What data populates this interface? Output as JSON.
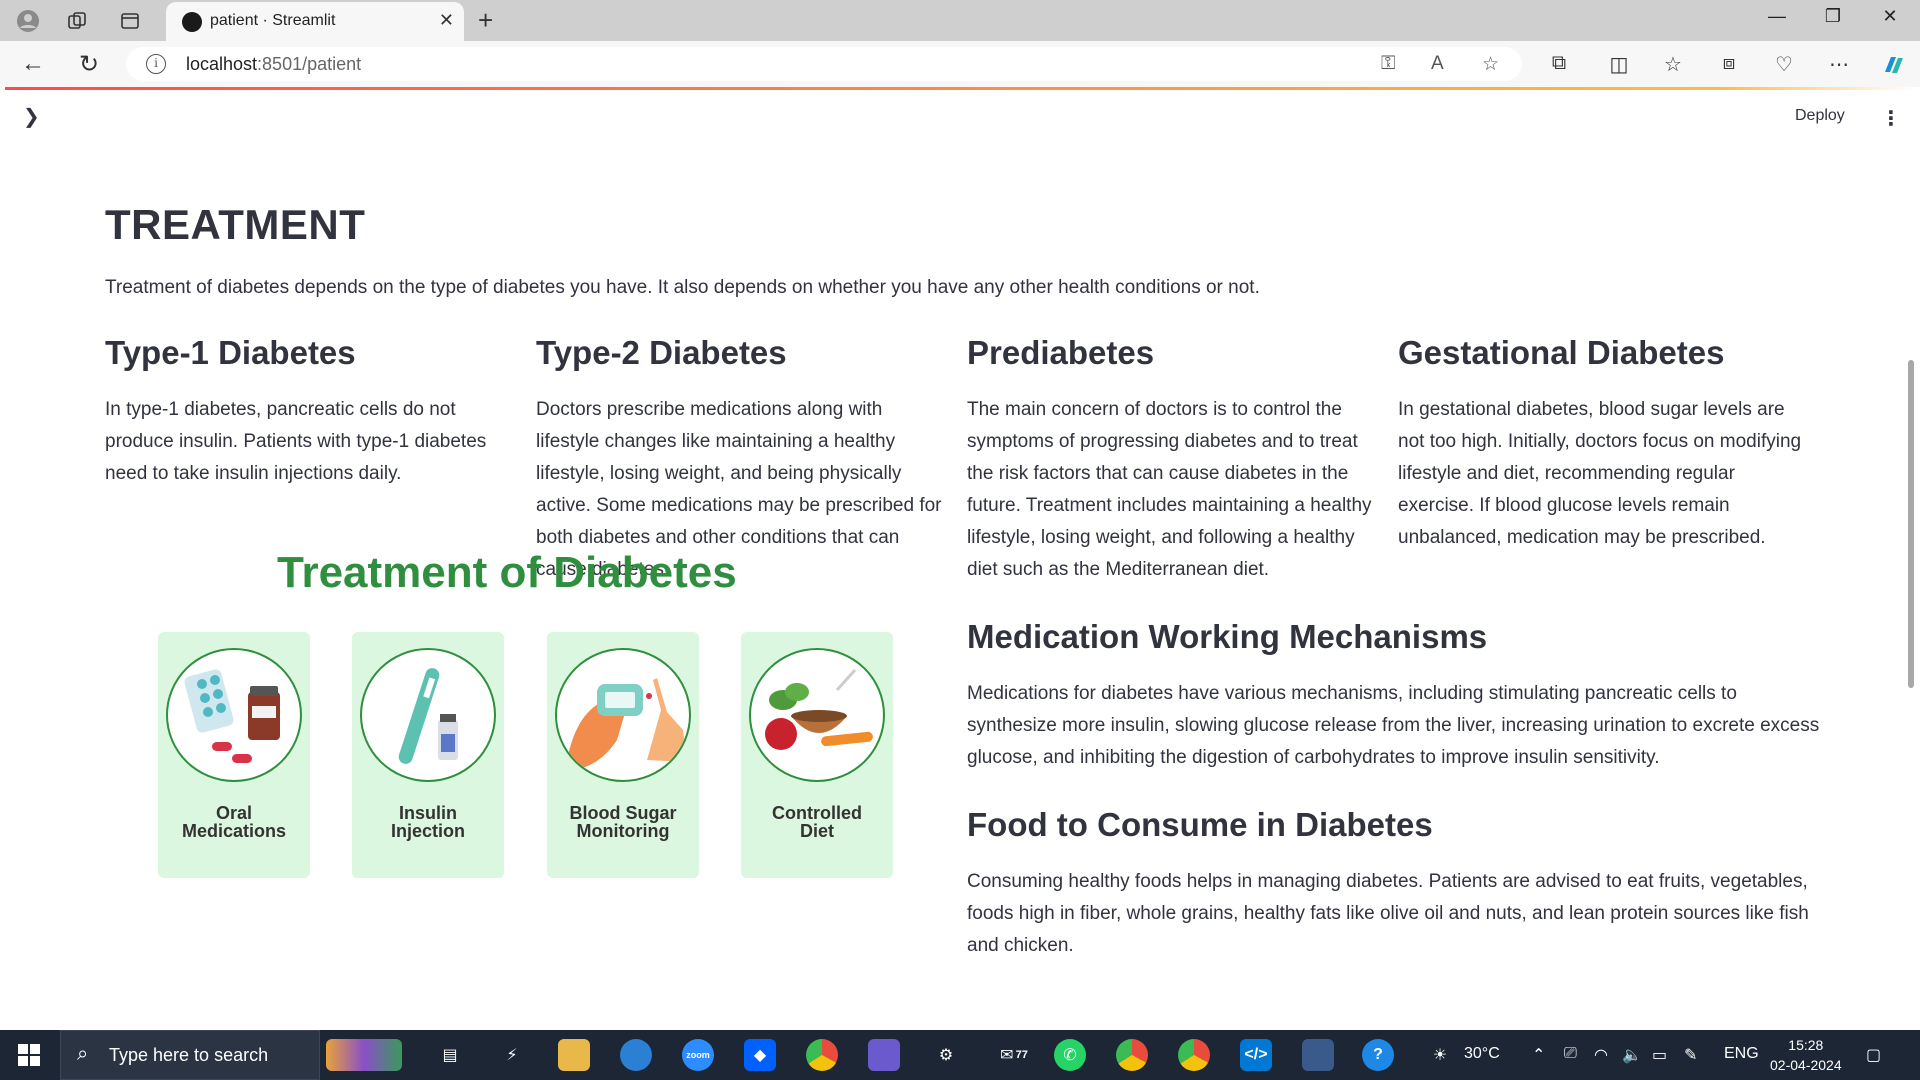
{
  "browser": {
    "tab_title": "patient · Streamlit",
    "url_host": "localhost",
    "url_path": ":8501/patient"
  },
  "header": {
    "deploy_label": "Deploy"
  },
  "main": {
    "title": "TREATMENT",
    "intro": "Treatment of diabetes depends on the type of diabetes you have. It also depends on whether you have any other health conditions or not.",
    "sections": [
      {
        "heading": "Type-1 Diabetes",
        "lines": [
          "In type-1 diabetes, pancreatic cells do not",
          "produce insulin. Patients with type-1 diabetes",
          "need to take insulin injections daily."
        ]
      },
      {
        "heading": "Type-2 Diabetes",
        "lines": [
          "Doctors prescribe medications along with",
          "lifestyle changes like maintaining a healthy",
          "lifestyle, losing weight, and being physically",
          "active. Some medications may be prescribed for",
          "both diabetes and other conditions that can",
          "cause diabetes."
        ]
      },
      {
        "heading": "Prediabetes",
        "lines": [
          "The main concern of doctors is to control the",
          "symptoms of progressing diabetes and to treat",
          "the risk factors that can cause diabetes in the",
          "future. Treatment includes maintaining a healthy",
          "lifestyle, losing weight, and following a healthy",
          "diet such as the Mediterranean diet."
        ]
      },
      {
        "heading": "Gestational Diabetes",
        "lines": [
          "In gestational diabetes, blood sugar levels are",
          "not too high. Initially, doctors focus on modifying",
          "lifestyle and diet, recommending regular",
          "exercise. If blood glucose levels remain",
          "unbalanced, medication may be prescribed."
        ]
      },
      {
        "heading": "Medication Working Mechanisms",
        "lines": [
          "Medications for diabetes have various mechanisms, including stimulating pancreatic cells to",
          "synthesize more insulin, slowing glucose release from the liver, increasing urination to excrete excess",
          "glucose, and inhibiting the digestion of carbohydrates to improve insulin sensitivity."
        ]
      },
      {
        "heading": "Food to Consume in Diabetes",
        "lines": [
          "Consuming healthy foods helps in managing diabetes. Patients are advised to eat fruits, vegetables,",
          "foods high in fiber, whole grains, healthy fats like olive oil and nuts, and lean protein sources like fish",
          "and chicken."
        ]
      }
    ],
    "infographic": {
      "title": "Treatment of Diabetes",
      "cards": [
        {
          "line1": "Oral",
          "line2": "Medications",
          "icon": "pills-icon"
        },
        {
          "line1": "Insulin",
          "line2": "Injection",
          "icon": "insulin-pen-icon"
        },
        {
          "line1": "Blood Sugar",
          "line2": "Monitoring",
          "icon": "glucometer-icon"
        },
        {
          "line1": "Controlled",
          "line2": "Diet",
          "icon": "food-bowl-icon"
        }
      ],
      "colors": {
        "title": "#2f8f3e",
        "card_bg": "#dcf7df"
      }
    }
  },
  "taskbar": {
    "search_placeholder": "Type here to search",
    "mail_badge": "77",
    "temperature": "30°C",
    "language": "ENG",
    "time": "15:28",
    "date": "02-04-2024"
  }
}
